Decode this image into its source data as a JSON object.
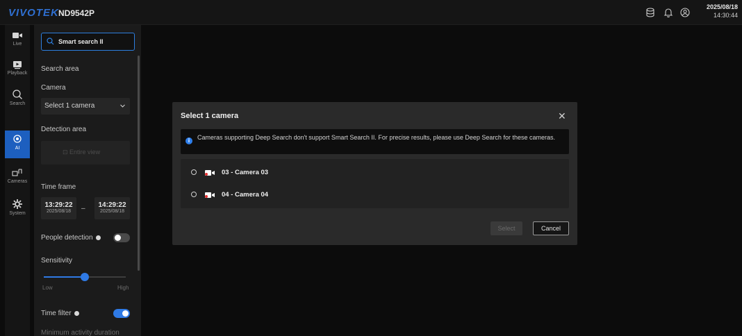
{
  "header": {
    "brand": "VIVOTEK",
    "model": "ND9542P",
    "icons": [
      "storage-icon",
      "bell-icon",
      "user-icon"
    ],
    "date": "2025/08/18",
    "time": "14:30:44"
  },
  "rail": {
    "items": [
      {
        "label": "Live",
        "icon": "live-video-icon"
      },
      {
        "label": "Playback",
        "icon": "playback-icon"
      },
      {
        "label": "Search",
        "icon": "search-icon"
      },
      {
        "label": "AI",
        "icon": "ai-icon",
        "active": true
      },
      {
        "label": "Cameras",
        "icon": "cameras-icon"
      },
      {
        "label": "System",
        "icon": "gear-icon"
      }
    ]
  },
  "panel": {
    "search_button": "Smart search II",
    "search_area": "Search area",
    "camera_label": "Camera",
    "camera_select": "Select 1 camera",
    "detection_area": "Detection area",
    "entire_view": "Entire view",
    "time_frame": "Time frame",
    "start_time": "13:29:22",
    "start_date": "2025/08/18",
    "end_time": "14:29:22",
    "end_date": "2025/08/18",
    "people_detection": "People detection",
    "people_detection_on": false,
    "sensitivity": "Sensitivity",
    "sensitivity_level": 0.5,
    "low": "Low",
    "high": "High",
    "time_filter": "Time filter",
    "time_filter_on": true,
    "min_activity": "Minimum activity duration"
  },
  "dialog": {
    "title": "Select 1 camera",
    "notice": "Cameras supporting Deep Search don't support Smart Search II. For precise results, please use Deep Search for these cameras.",
    "cameras": [
      {
        "label": "03 - Camera 03"
      },
      {
        "label": "04 - Camera 04"
      }
    ],
    "select_button": "Select",
    "cancel_button": "Cancel"
  },
  "colors": {
    "accent": "#2f7ae5",
    "brand": "#2f6fd0",
    "camera_icon_red": "#e53030"
  }
}
